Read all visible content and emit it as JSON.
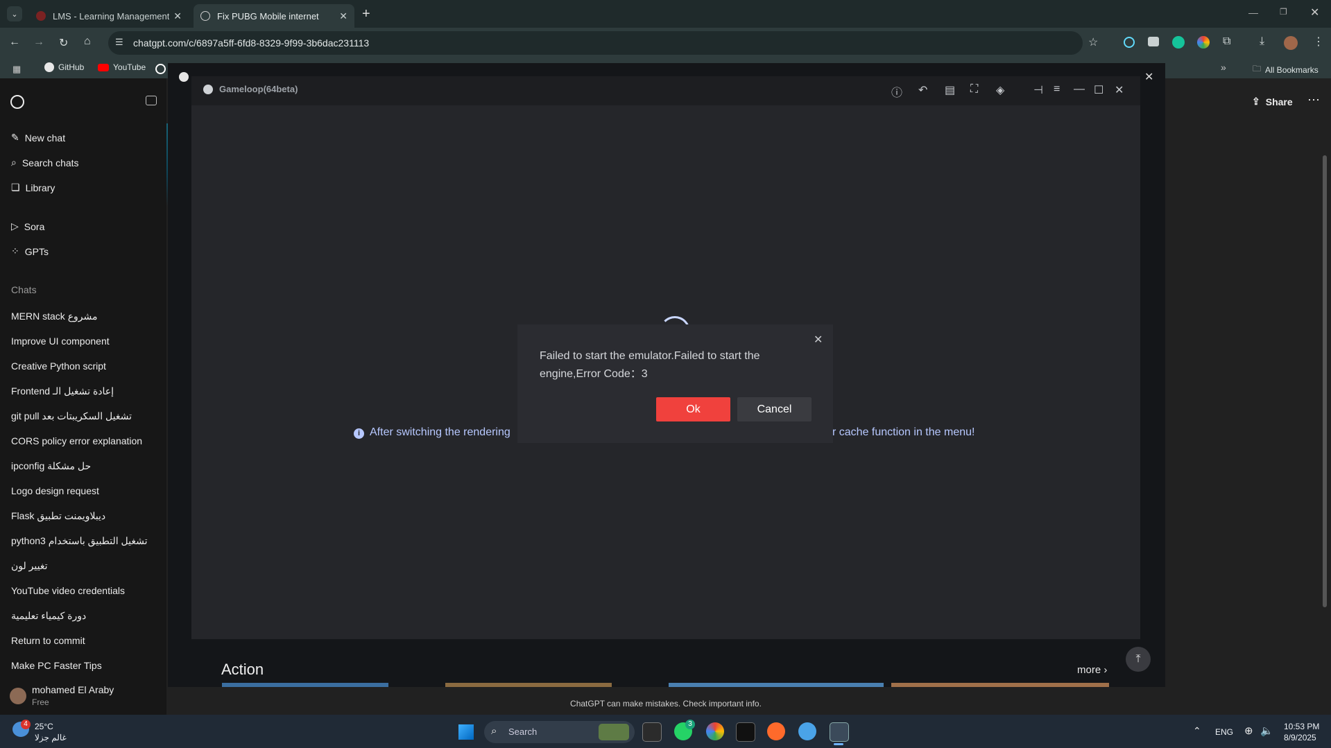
{
  "browser": {
    "tabs": [
      {
        "label": "LMS - Learning Management Sy",
        "active": false
      },
      {
        "label": "Fix PUBG Mobile internet",
        "active": true
      }
    ],
    "url": "chatgpt.com/c/6897a5ff-6fd8-8329-9f99-3b6dac231113",
    "bookmarks": [
      "GitHub",
      "YouTube"
    ],
    "all_bookmarks": "All Bookmarks"
  },
  "sidebar": {
    "actions": [
      {
        "label": "New chat",
        "icon": "edit-icon"
      },
      {
        "label": "Search chats",
        "icon": "search-icon"
      },
      {
        "label": "Library",
        "icon": "library-icon"
      }
    ],
    "apps": [
      {
        "label": "Sora",
        "icon": "play-circle-icon"
      },
      {
        "label": "GPTs",
        "icon": "grid-icon"
      }
    ],
    "chats_label": "Chats",
    "chats": [
      "MERN stack مشروع",
      "Improve UI component",
      "Creative Python script",
      "Frontend إعادة تشغيل الـ",
      "git pull تشغيل السكريبتات بعد",
      "CORS policy error explanation",
      "ipconfig حل مشكلة",
      "Logo design request",
      "Flask ديبلاويمنت تطبيق",
      "python3 تشغيل التطبيق باستخدام",
      "تغيير لون",
      "YouTube video credentials",
      "دورة كيمياء تعليمية",
      "Return to commit",
      "Make PC Faster Tips"
    ],
    "user": {
      "name": "mohamed El Araby",
      "plan": "Free"
    }
  },
  "header": {
    "share_label": "Share"
  },
  "gameloop": {
    "title": "Gameloop(64beta)",
    "notice_left": "After switching the rendering",
    "notice_right": "r cache function in the menu!",
    "dialog": {
      "message": "Failed to start the emulator.Failed to start the engine,Error Code：3",
      "ok_label": "Ok",
      "cancel_label": "Cancel",
      "ok_color": "#f0413d",
      "cancel_color": "#3a3b40"
    },
    "section_title": "Action",
    "more_label": "more"
  },
  "footer": {
    "disclaimer": "ChatGPT can make mistakes. Check important info."
  },
  "taskbar": {
    "weather_temp": "25°C",
    "weather_desc": "غالم جزلا",
    "weather_badge": "4",
    "search_placeholder": "Search",
    "whatsapp_badge": "3",
    "language": "ENG",
    "time": "10:53 PM",
    "date": "8/9/2025"
  }
}
